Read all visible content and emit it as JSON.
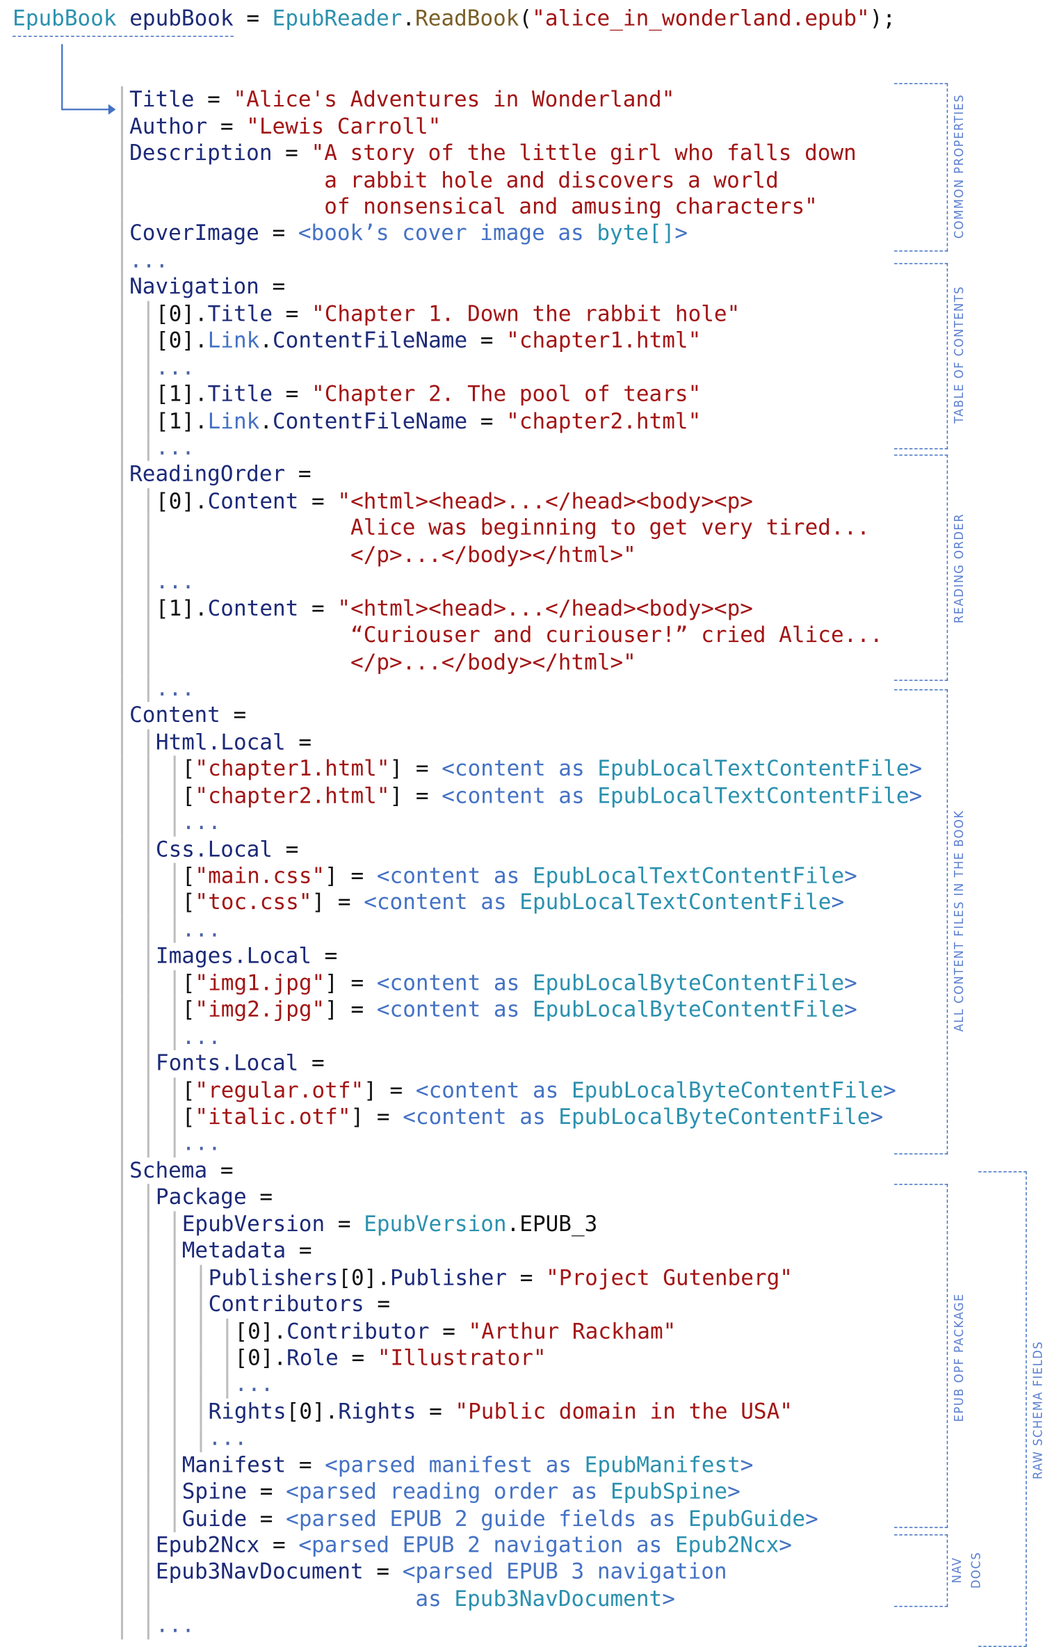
{
  "header": {
    "tokens": [
      {
        "c": "t",
        "t": "EpubBook"
      },
      {
        "c": "n",
        "t": " epubBook"
      },
      {
        "c": "p",
        "t": " = "
      },
      {
        "c": "t",
        "t": "EpubReader"
      },
      {
        "c": "p",
        "t": "."
      },
      {
        "c": "m",
        "t": "ReadBook"
      },
      {
        "c": "p",
        "t": "("
      },
      {
        "c": "s",
        "t": "\"alice_in_wonderland.epub\""
      },
      {
        "c": "p",
        "t": ");"
      }
    ]
  },
  "lines": [
    {
      "level": 0,
      "tokens": [
        {
          "c": "n",
          "t": "Title"
        },
        {
          "c": "p",
          "t": " = "
        },
        {
          "c": "s",
          "t": "\"Alice's Adventures in Wonderland\""
        }
      ]
    },
    {
      "level": 0,
      "tokens": [
        {
          "c": "n",
          "t": "Author"
        },
        {
          "c": "p",
          "t": " = "
        },
        {
          "c": "s",
          "t": "\"Lewis Carroll\""
        }
      ]
    },
    {
      "level": 0,
      "tokens": [
        {
          "c": "n",
          "t": "Description"
        },
        {
          "c": "p",
          "t": " = "
        },
        {
          "c": "s",
          "t": "\"A story of the little girl who falls down"
        }
      ]
    },
    {
      "level": 0,
      "tokens": [
        {
          "c": "s",
          "t": "               a rabbit hole and discovers a world"
        }
      ]
    },
    {
      "level": 0,
      "tokens": [
        {
          "c": "s",
          "t": "               of nonsensical and amusing characters\""
        }
      ]
    },
    {
      "level": 0,
      "tokens": [
        {
          "c": "n",
          "t": "CoverImage"
        },
        {
          "c": "p",
          "t": " = "
        },
        {
          "c": "b",
          "t": "<book’s cover image as "
        },
        {
          "c": "t",
          "t": "byte[]"
        },
        {
          "c": "b",
          "t": ">"
        }
      ]
    },
    {
      "level": 0,
      "tokens": [
        {
          "c": "d",
          "t": "..."
        }
      ]
    },
    {
      "level": 0,
      "tokens": [
        {
          "c": "n",
          "t": "Navigation"
        },
        {
          "c": "p",
          "t": " ="
        }
      ]
    },
    {
      "level": 1,
      "tokens": [
        {
          "c": "p",
          "t": "[0]."
        },
        {
          "c": "n",
          "t": "Title"
        },
        {
          "c": "p",
          "t": " = "
        },
        {
          "c": "s",
          "t": "\"Chapter 1. Down the rabbit hole\""
        }
      ]
    },
    {
      "level": 1,
      "tokens": [
        {
          "c": "p",
          "t": "[0]."
        },
        {
          "c": "b",
          "t": "Link"
        },
        {
          "c": "p",
          "t": "."
        },
        {
          "c": "n",
          "t": "ContentFileName"
        },
        {
          "c": "p",
          "t": " = "
        },
        {
          "c": "s",
          "t": "\"chapter1.html\""
        }
      ]
    },
    {
      "level": 1,
      "tokens": [
        {
          "c": "d",
          "t": "..."
        }
      ]
    },
    {
      "level": 1,
      "tokens": [
        {
          "c": "p",
          "t": "[1]."
        },
        {
          "c": "n",
          "t": "Title"
        },
        {
          "c": "p",
          "t": " = "
        },
        {
          "c": "s",
          "t": "\"Chapter 2. The pool of tears\""
        }
      ]
    },
    {
      "level": 1,
      "tokens": [
        {
          "c": "p",
          "t": "[1]."
        },
        {
          "c": "b",
          "t": "Link"
        },
        {
          "c": "p",
          "t": "."
        },
        {
          "c": "n",
          "t": "ContentFileName"
        },
        {
          "c": "p",
          "t": " = "
        },
        {
          "c": "s",
          "t": "\"chapter2.html\""
        }
      ]
    },
    {
      "level": 1,
      "tokens": [
        {
          "c": "d",
          "t": "..."
        }
      ]
    },
    {
      "level": 0,
      "tokens": [
        {
          "c": "n",
          "t": "ReadingOrder"
        },
        {
          "c": "p",
          "t": " ="
        }
      ]
    },
    {
      "level": 1,
      "tokens": [
        {
          "c": "p",
          "t": "[0]."
        },
        {
          "c": "n",
          "t": "Content"
        },
        {
          "c": "p",
          "t": " = "
        },
        {
          "c": "s",
          "t": "\"<html><head>...</head><body><p>"
        }
      ]
    },
    {
      "level": 1,
      "tokens": [
        {
          "c": "s",
          "t": "               Alice was beginning to get very tired..."
        }
      ]
    },
    {
      "level": 1,
      "tokens": [
        {
          "c": "s",
          "t": "               </p>...</body></html>\""
        }
      ]
    },
    {
      "level": 1,
      "tokens": [
        {
          "c": "d",
          "t": "..."
        }
      ]
    },
    {
      "level": 1,
      "tokens": [
        {
          "c": "p",
          "t": "[1]."
        },
        {
          "c": "n",
          "t": "Content"
        },
        {
          "c": "p",
          "t": " = "
        },
        {
          "c": "s",
          "t": "\"<html><head>...</head><body><p>"
        }
      ]
    },
    {
      "level": 1,
      "tokens": [
        {
          "c": "s",
          "t": "               “Curiouser and curiouser!” cried Alice..."
        }
      ]
    },
    {
      "level": 1,
      "tokens": [
        {
          "c": "s",
          "t": "               </p>...</body></html>\""
        }
      ]
    },
    {
      "level": 1,
      "tokens": [
        {
          "c": "d",
          "t": "..."
        }
      ]
    },
    {
      "level": 0,
      "tokens": [
        {
          "c": "n",
          "t": "Content"
        },
        {
          "c": "p",
          "t": " ="
        }
      ]
    },
    {
      "level": 1,
      "tokens": [
        {
          "c": "n",
          "t": "Html.Local"
        },
        {
          "c": "p",
          "t": " ="
        }
      ]
    },
    {
      "level": 2,
      "tokens": [
        {
          "c": "p",
          "t": "["
        },
        {
          "c": "s",
          "t": "\"chapter1.html\""
        },
        {
          "c": "p",
          "t": "] = "
        },
        {
          "c": "b",
          "t": "<content as "
        },
        {
          "c": "t",
          "t": "EpubLocalTextContentFile"
        },
        {
          "c": "b",
          "t": ">"
        }
      ]
    },
    {
      "level": 2,
      "tokens": [
        {
          "c": "p",
          "t": "["
        },
        {
          "c": "s",
          "t": "\"chapter2.html\""
        },
        {
          "c": "p",
          "t": "] = "
        },
        {
          "c": "b",
          "t": "<content as "
        },
        {
          "c": "t",
          "t": "EpubLocalTextContentFile"
        },
        {
          "c": "b",
          "t": ">"
        }
      ]
    },
    {
      "level": 2,
      "tokens": [
        {
          "c": "d",
          "t": "..."
        }
      ]
    },
    {
      "level": 1,
      "tokens": [
        {
          "c": "n",
          "t": "Css.Local"
        },
        {
          "c": "p",
          "t": " ="
        }
      ]
    },
    {
      "level": 2,
      "tokens": [
        {
          "c": "p",
          "t": "["
        },
        {
          "c": "s",
          "t": "\"main.css\""
        },
        {
          "c": "p",
          "t": "] = "
        },
        {
          "c": "b",
          "t": "<content as "
        },
        {
          "c": "t",
          "t": "EpubLocalTextContentFile"
        },
        {
          "c": "b",
          "t": ">"
        }
      ]
    },
    {
      "level": 2,
      "tokens": [
        {
          "c": "p",
          "t": "["
        },
        {
          "c": "s",
          "t": "\"toc.css\""
        },
        {
          "c": "p",
          "t": "] = "
        },
        {
          "c": "b",
          "t": "<content as "
        },
        {
          "c": "t",
          "t": "EpubLocalTextContentFile"
        },
        {
          "c": "b",
          "t": ">"
        }
      ]
    },
    {
      "level": 2,
      "tokens": [
        {
          "c": "d",
          "t": "..."
        }
      ]
    },
    {
      "level": 1,
      "tokens": [
        {
          "c": "n",
          "t": "Images.Local"
        },
        {
          "c": "p",
          "t": " ="
        }
      ]
    },
    {
      "level": 2,
      "tokens": [
        {
          "c": "p",
          "t": "["
        },
        {
          "c": "s",
          "t": "\"img1.jpg\""
        },
        {
          "c": "p",
          "t": "] = "
        },
        {
          "c": "b",
          "t": "<content as "
        },
        {
          "c": "t",
          "t": "EpubLocalByteContentFile"
        },
        {
          "c": "b",
          "t": ">"
        }
      ]
    },
    {
      "level": 2,
      "tokens": [
        {
          "c": "p",
          "t": "["
        },
        {
          "c": "s",
          "t": "\"img2.jpg\""
        },
        {
          "c": "p",
          "t": "] = "
        },
        {
          "c": "b",
          "t": "<content as "
        },
        {
          "c": "t",
          "t": "EpubLocalByteContentFile"
        },
        {
          "c": "b",
          "t": ">"
        }
      ]
    },
    {
      "level": 2,
      "tokens": [
        {
          "c": "d",
          "t": "..."
        }
      ]
    },
    {
      "level": 1,
      "tokens": [
        {
          "c": "n",
          "t": "Fonts.Local"
        },
        {
          "c": "p",
          "t": " ="
        }
      ]
    },
    {
      "level": 2,
      "tokens": [
        {
          "c": "p",
          "t": "["
        },
        {
          "c": "s",
          "t": "\"regular.otf\""
        },
        {
          "c": "p",
          "t": "] = "
        },
        {
          "c": "b",
          "t": "<content as "
        },
        {
          "c": "t",
          "t": "EpubLocalByteContentFile"
        },
        {
          "c": "b",
          "t": ">"
        }
      ]
    },
    {
      "level": 2,
      "tokens": [
        {
          "c": "p",
          "t": "["
        },
        {
          "c": "s",
          "t": "\"italic.otf\""
        },
        {
          "c": "p",
          "t": "] = "
        },
        {
          "c": "b",
          "t": "<content as "
        },
        {
          "c": "t",
          "t": "EpubLocalByteContentFile"
        },
        {
          "c": "b",
          "t": ">"
        }
      ]
    },
    {
      "level": 2,
      "tokens": [
        {
          "c": "d",
          "t": "..."
        }
      ]
    },
    {
      "level": 0,
      "tokens": [
        {
          "c": "n",
          "t": "Schema"
        },
        {
          "c": "p",
          "t": " ="
        }
      ]
    },
    {
      "level": 1,
      "tokens": [
        {
          "c": "n",
          "t": "Package"
        },
        {
          "c": "p",
          "t": " ="
        }
      ]
    },
    {
      "level": 2,
      "tokens": [
        {
          "c": "n",
          "t": "EpubVersion"
        },
        {
          "c": "p",
          "t": " = "
        },
        {
          "c": "t",
          "t": "EpubVersion"
        },
        {
          "c": "p",
          "t": ".EPUB_3"
        }
      ]
    },
    {
      "level": 2,
      "tokens": [
        {
          "c": "n",
          "t": "Metadata"
        },
        {
          "c": "p",
          "t": " ="
        }
      ]
    },
    {
      "level": 3,
      "tokens": [
        {
          "c": "n",
          "t": "Publishers"
        },
        {
          "c": "p",
          "t": "[0]."
        },
        {
          "c": "n",
          "t": "Publisher"
        },
        {
          "c": "p",
          "t": " = "
        },
        {
          "c": "s",
          "t": "\"Project Gutenberg\""
        }
      ]
    },
    {
      "level": 3,
      "tokens": [
        {
          "c": "n",
          "t": "Contributors"
        },
        {
          "c": "p",
          "t": " ="
        }
      ]
    },
    {
      "level": 4,
      "tokens": [
        {
          "c": "p",
          "t": "[0]."
        },
        {
          "c": "n",
          "t": "Contributor"
        },
        {
          "c": "p",
          "t": " = "
        },
        {
          "c": "s",
          "t": "\"Arthur Rackham\""
        }
      ]
    },
    {
      "level": 4,
      "tokens": [
        {
          "c": "p",
          "t": "[0]."
        },
        {
          "c": "n",
          "t": "Role"
        },
        {
          "c": "p",
          "t": " = "
        },
        {
          "c": "s",
          "t": "\"Illustrator\""
        }
      ]
    },
    {
      "level": 4,
      "tokens": [
        {
          "c": "d",
          "t": "..."
        }
      ]
    },
    {
      "level": 3,
      "tokens": [
        {
          "c": "n",
          "t": "Rights"
        },
        {
          "c": "p",
          "t": "[0]."
        },
        {
          "c": "n",
          "t": "Rights"
        },
        {
          "c": "p",
          "t": " = "
        },
        {
          "c": "s",
          "t": "\"Public domain in the USA\""
        }
      ]
    },
    {
      "level": 3,
      "tokens": [
        {
          "c": "d",
          "t": "..."
        }
      ]
    },
    {
      "level": 2,
      "tokens": [
        {
          "c": "n",
          "t": "Manifest"
        },
        {
          "c": "p",
          "t": " = "
        },
        {
          "c": "b",
          "t": "<parsed manifest as "
        },
        {
          "c": "t",
          "t": "EpubManifest"
        },
        {
          "c": "b",
          "t": ">"
        }
      ]
    },
    {
      "level": 2,
      "tokens": [
        {
          "c": "n",
          "t": "Spine"
        },
        {
          "c": "p",
          "t": " = "
        },
        {
          "c": "b",
          "t": "<parsed reading order as "
        },
        {
          "c": "t",
          "t": "EpubSpine"
        },
        {
          "c": "b",
          "t": ">"
        }
      ]
    },
    {
      "level": 2,
      "tokens": [
        {
          "c": "n",
          "t": "Guide"
        },
        {
          "c": "p",
          "t": " = "
        },
        {
          "c": "b",
          "t": "<parsed EPUB 2 guide fields as "
        },
        {
          "c": "t",
          "t": "EpubGuide"
        },
        {
          "c": "b",
          "t": ">"
        }
      ]
    },
    {
      "level": 1,
      "tokens": [
        {
          "c": "n",
          "t": "Epub2Ncx"
        },
        {
          "c": "p",
          "t": " = "
        },
        {
          "c": "b",
          "t": "<parsed EPUB 2 navigation as "
        },
        {
          "c": "t",
          "t": "Epub2Ncx"
        },
        {
          "c": "b",
          "t": ">"
        }
      ]
    },
    {
      "level": 1,
      "tokens": [
        {
          "c": "n",
          "t": "Epub3NavDocument"
        },
        {
          "c": "p",
          "t": " = "
        },
        {
          "c": "b",
          "t": "<parsed EPUB 3 navigation"
        }
      ]
    },
    {
      "level": 1,
      "tokens": [
        {
          "c": "b",
          "t": "                    as "
        },
        {
          "c": "t",
          "t": "Epub3NavDocument"
        },
        {
          "c": "b",
          "t": ">"
        }
      ]
    },
    {
      "level": 1,
      "tokens": [
        {
          "c": "d",
          "t": "..."
        }
      ]
    }
  ],
  "labels": {
    "common": "COMMON PROPERTIES",
    "toc": "TABLE OF CONTENTS",
    "reading": "READING ORDER",
    "content": "ALL CONTENT FILES IN THE BOOK",
    "opf": "EPUB OPF PACKAGE",
    "nav1": "NAV",
    "nav2": "DOCS",
    "raw": "RAW SCHEMA FIELDS"
  },
  "colors": {
    "identifier": "#1c2a78",
    "string": "#a31515",
    "type": "#2b91af",
    "placeholder": "#4472c4",
    "method": "#795e26",
    "bracket": "#4472c4"
  }
}
